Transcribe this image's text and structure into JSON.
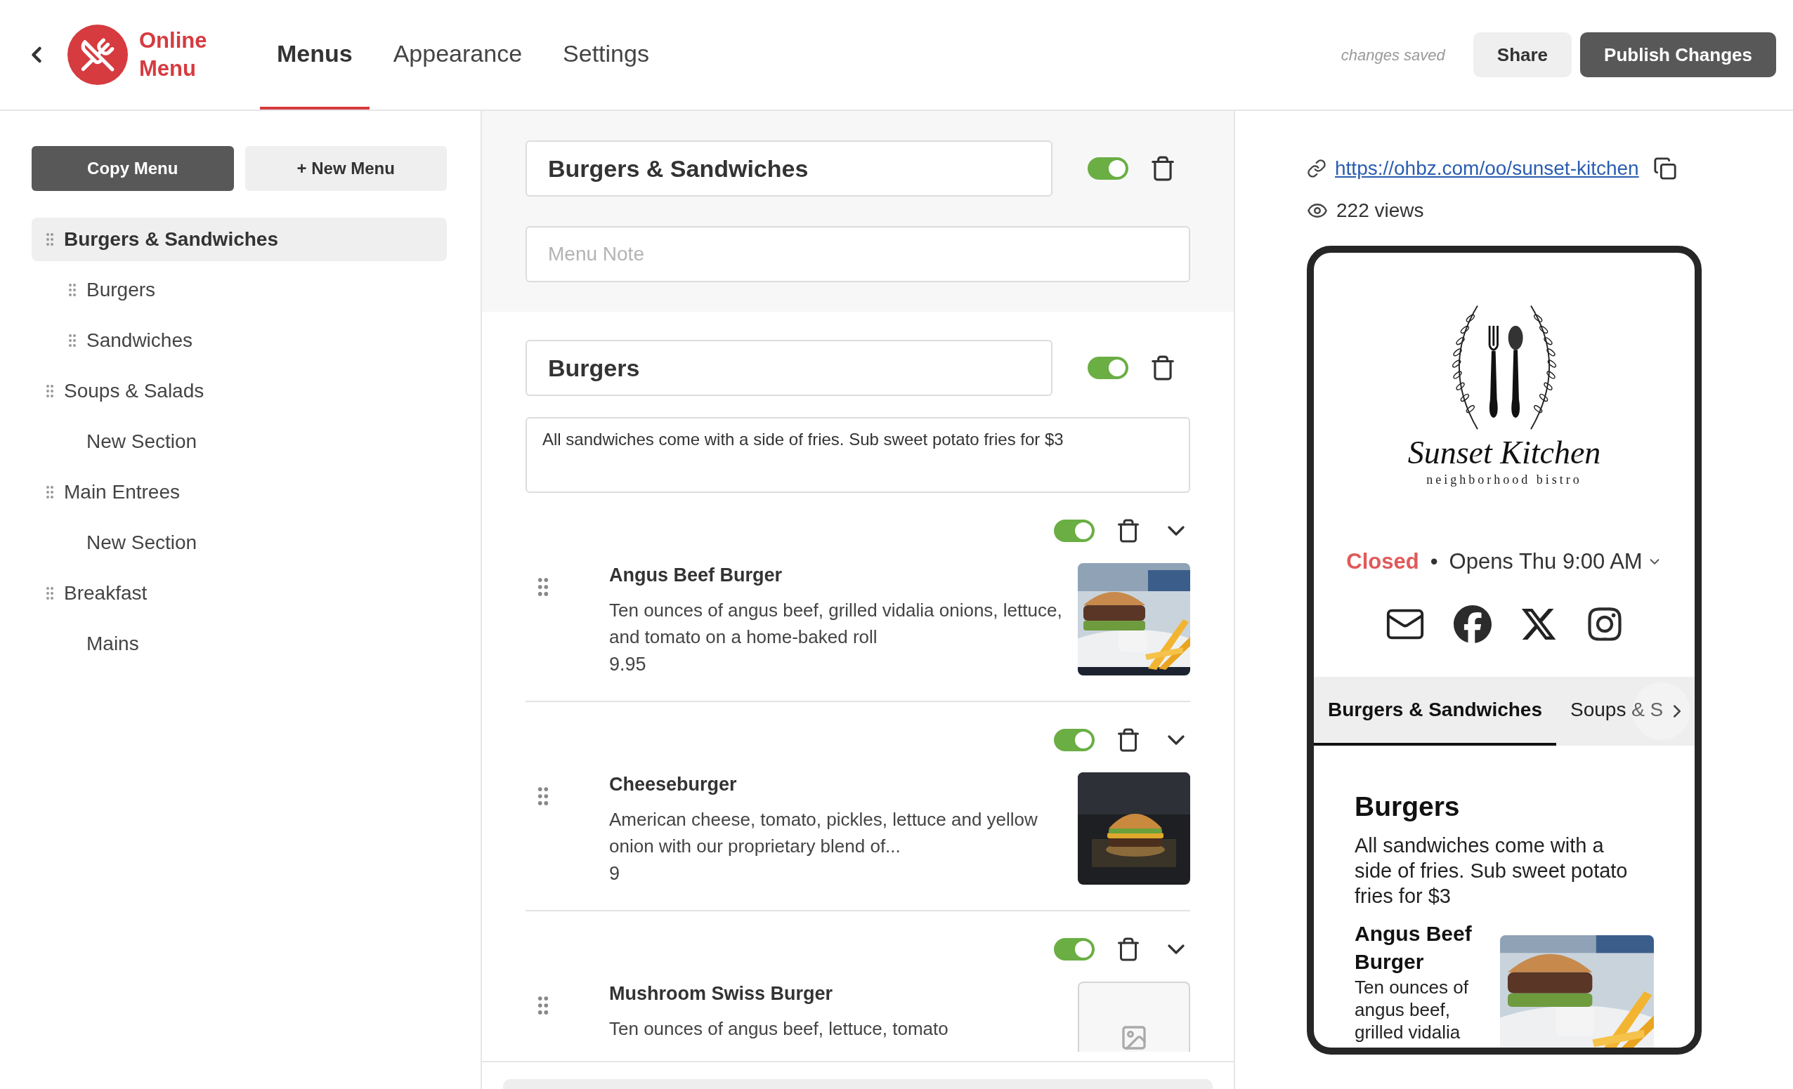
{
  "header": {
    "logo_text": "Online Menu",
    "tabs": [
      {
        "label": "Menus",
        "selected": true
      },
      {
        "label": "Appearance",
        "selected": false
      },
      {
        "label": "Settings",
        "selected": false
      }
    ],
    "save_status": "changes saved",
    "buttons": [
      {
        "label": "Share",
        "kind": "secondary"
      },
      {
        "label": "Publish Changes",
        "kind": "primary"
      }
    ]
  },
  "sidebar": {
    "buttons": [
      {
        "label": "Copy Menu",
        "kind": "primary"
      },
      {
        "label": "+ New Menu",
        "kind": "secondary"
      }
    ],
    "menus": [
      {
        "label": "Burgers & Sandwiches",
        "selected": true,
        "children": [
          {
            "label": "Burgers",
            "handle": true,
            "selected": false
          },
          {
            "label": "Sandwiches",
            "handle": true,
            "selected": false
          }
        ]
      },
      {
        "label": "Soups & Salads",
        "selected": false,
        "children": [
          {
            "label": "New Section",
            "handle": false,
            "selected": false
          }
        ]
      },
      {
        "label": "Main Entrees",
        "selected": false,
        "children": [
          {
            "label": "New Section",
            "handle": false,
            "selected": false
          }
        ]
      },
      {
        "label": "Breakfast",
        "selected": false,
        "children": [
          {
            "label": "Mains",
            "handle": false,
            "selected": false
          }
        ]
      }
    ]
  },
  "editor": {
    "menu": {
      "title": "Burgers & Sandwiches",
      "on": true,
      "note_placeholder": "Menu Note"
    },
    "section": {
      "title": "Burgers",
      "on": true,
      "note": "All sandwiches come with a side of fries. Sub sweet potato fries for $3"
    },
    "items": [
      {
        "name": "Angus Beef Burger",
        "description": "Ten ounces of angus beef, grilled vidalia onions, lettuce, and tomato on a home-baked roll",
        "price": "9.95",
        "on": true
      },
      {
        "name": "Cheeseburger",
        "description": "American cheese, tomato, pickles, lettuce and yellow onion with our proprietary blend of...",
        "price": "9",
        "on": true
      },
      {
        "name": "Mushroom Swiss Burger",
        "description": "Ten ounces of angus beef, lettuce, tomato",
        "on": true,
        "kind": "placeholder"
      }
    ]
  },
  "preview": {
    "link": "https://ohbz.com/oo/sunset-kitchen",
    "views": "222 views",
    "restaurant": {
      "name": "Sunset Kitchen",
      "tagline": "neighborhood bistro"
    },
    "status": {
      "state": "Closed",
      "separator": "•",
      "hours": "Opens Thu 9:00 AM"
    },
    "tabs": [
      {
        "label": "Burgers & Sandwiches",
        "selected": true
      },
      {
        "label": "Soups & S",
        "selected": false
      }
    ],
    "section": {
      "title": "Burgers",
      "description": "All sandwiches come with a side of fries. Sub sweet potato fries for $3"
    },
    "item": {
      "name": "Angus Beef Burger",
      "description": "Ten ounces of angus beef, grilled vidalia"
    }
  }
}
